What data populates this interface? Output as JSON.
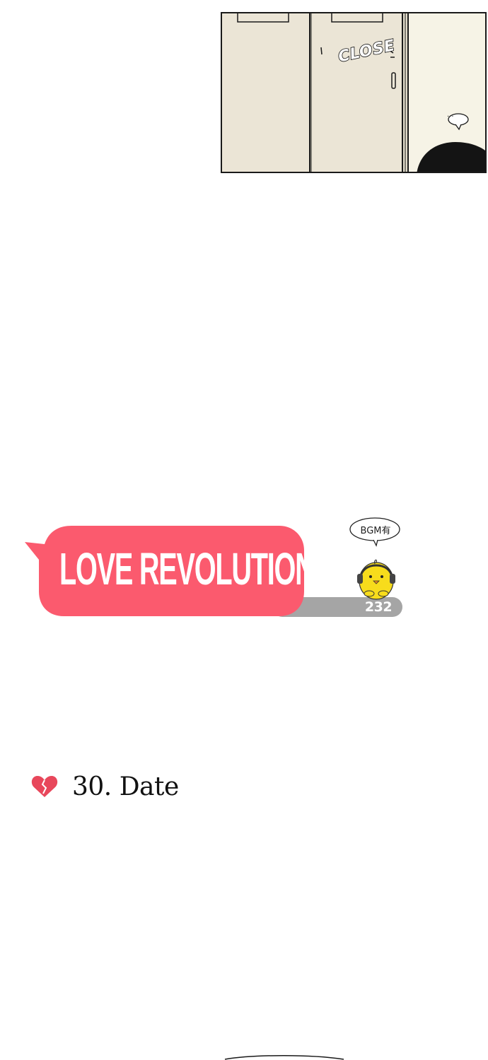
{
  "panel": {
    "sfx_text": "CLOSE",
    "speech_bubble_text": "···"
  },
  "title_banner": {
    "title": "LOVE REVOLUTION",
    "episode_number": "232",
    "bgm_label": "BGM有",
    "colors": {
      "banner": "#fb5a6e",
      "counter_bar": "#a5a5a5",
      "chick": "#f7dc1c"
    }
  },
  "chapter": {
    "icon": "broken-heart-icon",
    "title": "30. Date",
    "icon_color": "#e8475b"
  }
}
